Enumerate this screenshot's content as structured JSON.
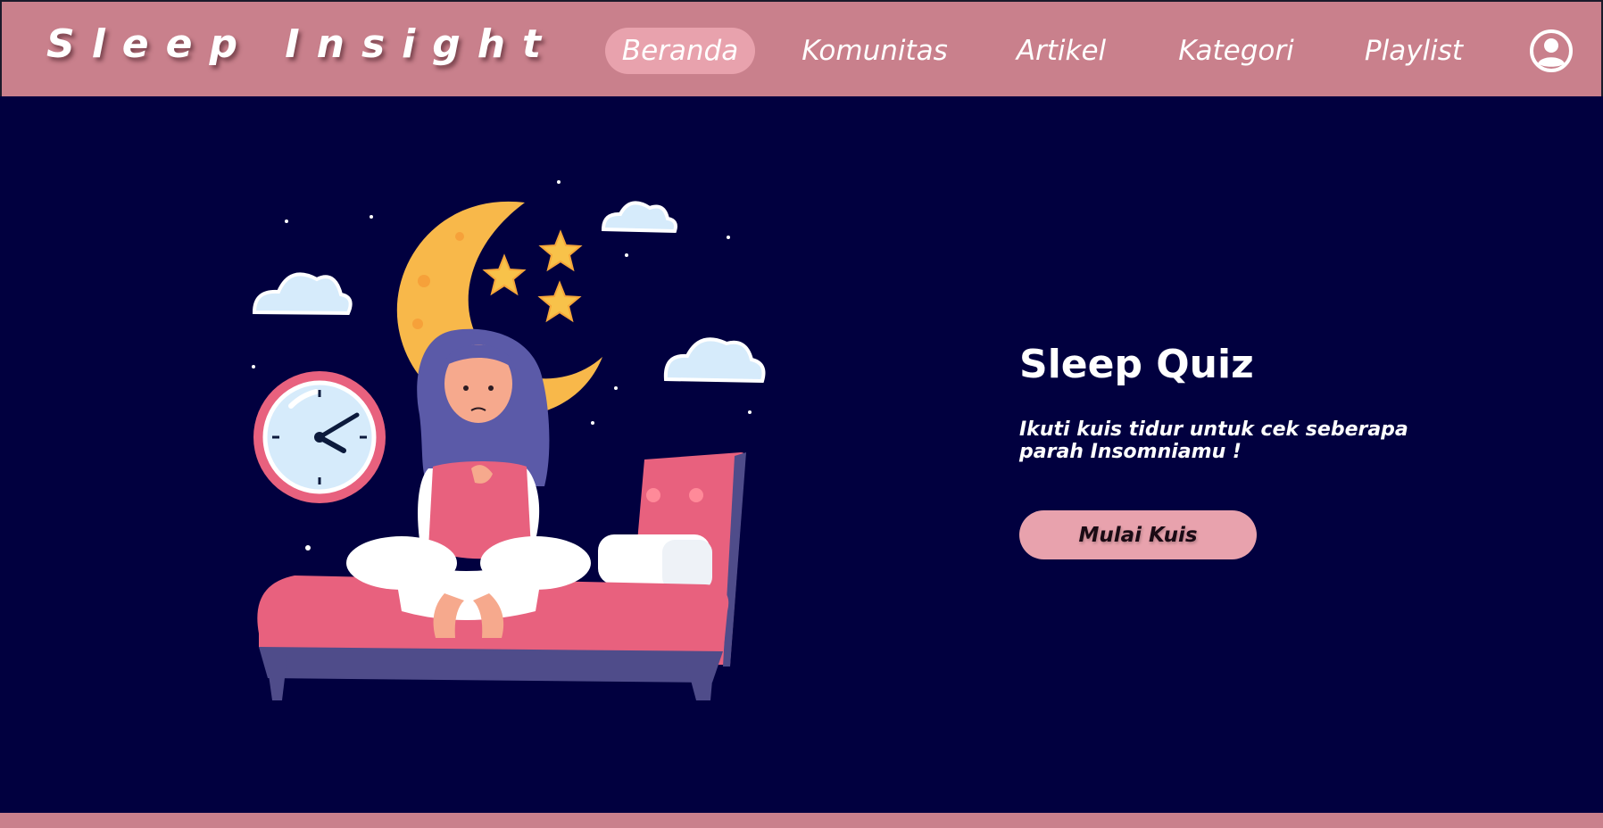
{
  "brand": {
    "name": "Sleep Insight"
  },
  "nav": {
    "items": [
      {
        "label": "Beranda",
        "active": true
      },
      {
        "label": "Komunitas",
        "active": false
      },
      {
        "label": "Artikel",
        "active": false
      },
      {
        "label": "Kategori",
        "active": false
      },
      {
        "label": "Playlist",
        "active": false
      }
    ],
    "user_icon": "user-circle-icon"
  },
  "hero": {
    "illustration": "sleepless-girl-on-bed-illustration",
    "quiz_title": "Sleep Quiz",
    "quiz_description": "Ikuti kuis tidur untuk cek seberapa parah Insomniamu !",
    "quiz_button_label": "Mulai Kuis"
  },
  "colors": {
    "navbar": "#c9808c",
    "background": "#01003f",
    "accent": "#e8a2ad",
    "text": "#ffffff"
  }
}
